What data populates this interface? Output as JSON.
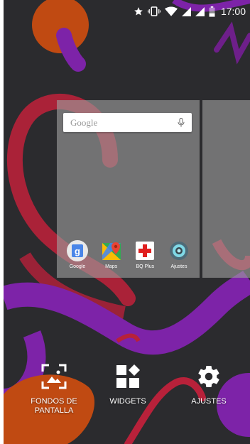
{
  "status_bar": {
    "time": "17:00",
    "icons": [
      "star-icon",
      "vibrate-icon",
      "wifi-icon",
      "signal-icon",
      "signal-icon",
      "battery-icon"
    ]
  },
  "home_page": {
    "search_bar": {
      "logo_text": "Google",
      "icon": "mic-icon"
    },
    "apps": [
      {
        "label": "Google",
        "icon": "google-app-icon"
      },
      {
        "label": "Maps",
        "icon": "maps-app-icon"
      },
      {
        "label": "BQ Plus",
        "icon": "bq-plus-icon"
      },
      {
        "label": "Ajustes",
        "icon": "settings-app-icon"
      }
    ]
  },
  "overview_actions": [
    {
      "label": "FONDOS DE\nPANTALLA",
      "icon": "wallpaper-icon"
    },
    {
      "label": "WIDGETS",
      "icon": "widgets-icon"
    },
    {
      "label": "AJUSTES",
      "icon": "gear-icon"
    }
  ],
  "colors": {
    "background": "#2b2b2e",
    "card": "#9e9e9e",
    "wallpaper_red": "#b8213a",
    "wallpaper_purple": "#7d23a8",
    "wallpaper_orange": "#c04a12"
  }
}
